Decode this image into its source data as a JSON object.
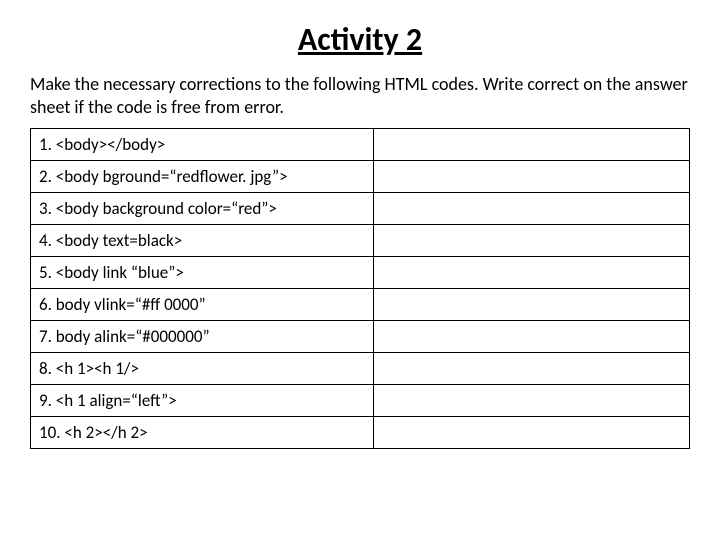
{
  "title": "Activity 2",
  "instructions": "Make the necessary corrections to the following HTML codes. Write correct on the answer sheet if the code is free from error.",
  "rows": [
    {
      "left": "1. <body></body>",
      "right": ""
    },
    {
      "left": "2. <body bground=“redflower. jpg”>",
      "right": ""
    },
    {
      "left": "3. <body background color=“red”>",
      "right": ""
    },
    {
      "left": "4. <body text=black>",
      "right": ""
    },
    {
      "left": "5. <body link “blue”>",
      "right": ""
    },
    {
      "left": "6. body vlink=“#ff 0000”",
      "right": ""
    },
    {
      "left": "7. body alink=“#000000”",
      "right": ""
    },
    {
      "left": "8. <h 1><h 1/>",
      "right": ""
    },
    {
      "left": "9. <h 1 align=“left”>",
      "right": ""
    },
    {
      "left": "10. <h 2></h 2>",
      "right": ""
    }
  ]
}
